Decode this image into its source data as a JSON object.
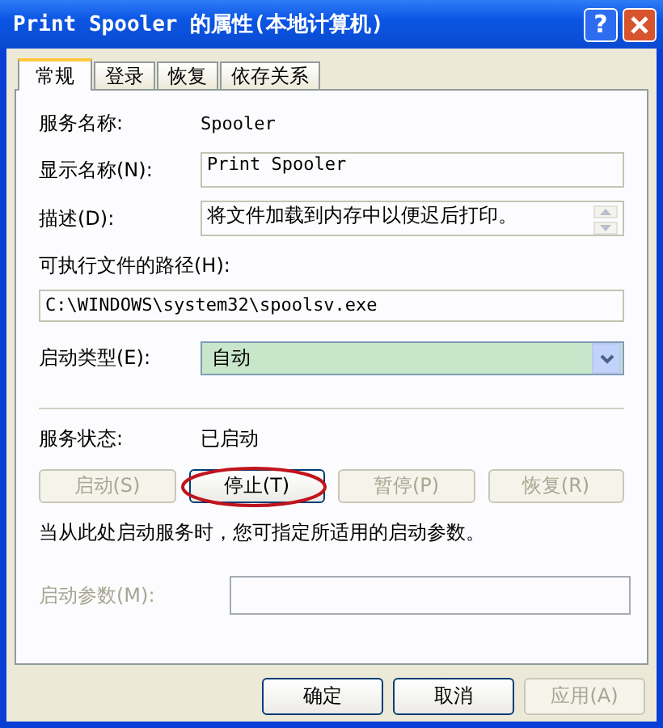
{
  "window": {
    "title": "Print Spooler 的属性(本地计算机)",
    "title_buttons": [
      {
        "kind": "help",
        "label": "?"
      },
      {
        "kind": "close"
      }
    ]
  },
  "tabs": [
    {
      "label": "常规",
      "selected": true
    },
    {
      "label": "登录",
      "selected": false
    },
    {
      "label": "恢复",
      "selected": false
    },
    {
      "label": "依存关系",
      "selected": false
    }
  ],
  "service_name": {
    "label": "服务名称:",
    "value": "Spooler"
  },
  "display_name": {
    "label": "显示名称(N):",
    "value": "Print Spooler"
  },
  "description": {
    "label": "描述(D):",
    "value": "将文件加载到内存中以便迟后打印。"
  },
  "path": {
    "label": "可执行文件的路径(H):",
    "value": "C:\\WINDOWS\\system32\\spoolsv.exe"
  },
  "startup_type": {
    "label": "启动类型(E):",
    "value": "自动"
  },
  "service_status": {
    "label": "服务状态:",
    "value": "已启动"
  },
  "control_buttons": [
    {
      "label": "启动(S)",
      "disabled": true,
      "highlighted": false
    },
    {
      "label": "停止(T)",
      "disabled": false,
      "highlighted": true
    },
    {
      "label": "暂停(P)",
      "disabled": true,
      "highlighted": false
    },
    {
      "label": "恢复(R)",
      "disabled": true,
      "highlighted": false
    }
  ],
  "hint": "当从此处启动服务时，您可指定所适用的启动参数。",
  "start_parameters": {
    "label": "启动参数(M):",
    "disabled": true
  },
  "dialog_buttons": [
    {
      "label": "确定",
      "disabled": false
    },
    {
      "label": "取消",
      "disabled": false
    },
    {
      "label": "应用(A)",
      "disabled": true
    }
  ]
}
